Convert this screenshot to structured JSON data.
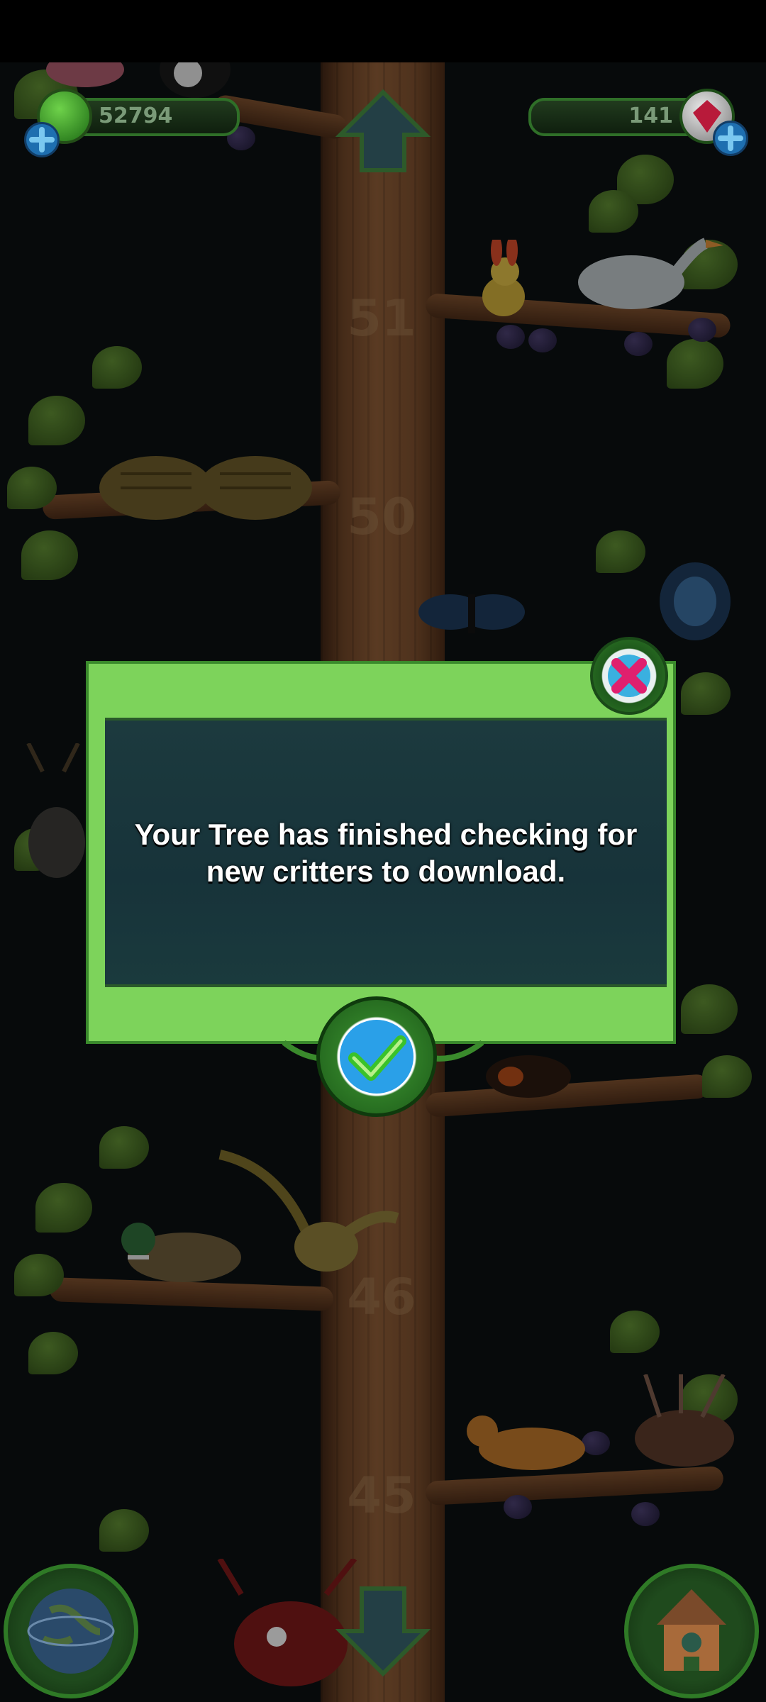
{
  "hud": {
    "green_currency_value": "52794",
    "gem_currency_value": "141"
  },
  "tree": {
    "level_labels": [
      "51",
      "50",
      "46",
      "45"
    ]
  },
  "dialog": {
    "message": "Your Tree has finished checking for new critters to download."
  },
  "icons": {
    "close": "close-x-icon",
    "confirm": "checkmark-icon",
    "up": "up-arrow-icon",
    "down": "down-arrow-icon",
    "globe": "globe-icon",
    "house": "birdhouse-icon"
  },
  "colors": {
    "dialog_frame": "#7dd35b",
    "dialog_panel": "#1c3a3e",
    "close_accent": "#e0206e",
    "confirm_accent": "#2aa0e8"
  }
}
